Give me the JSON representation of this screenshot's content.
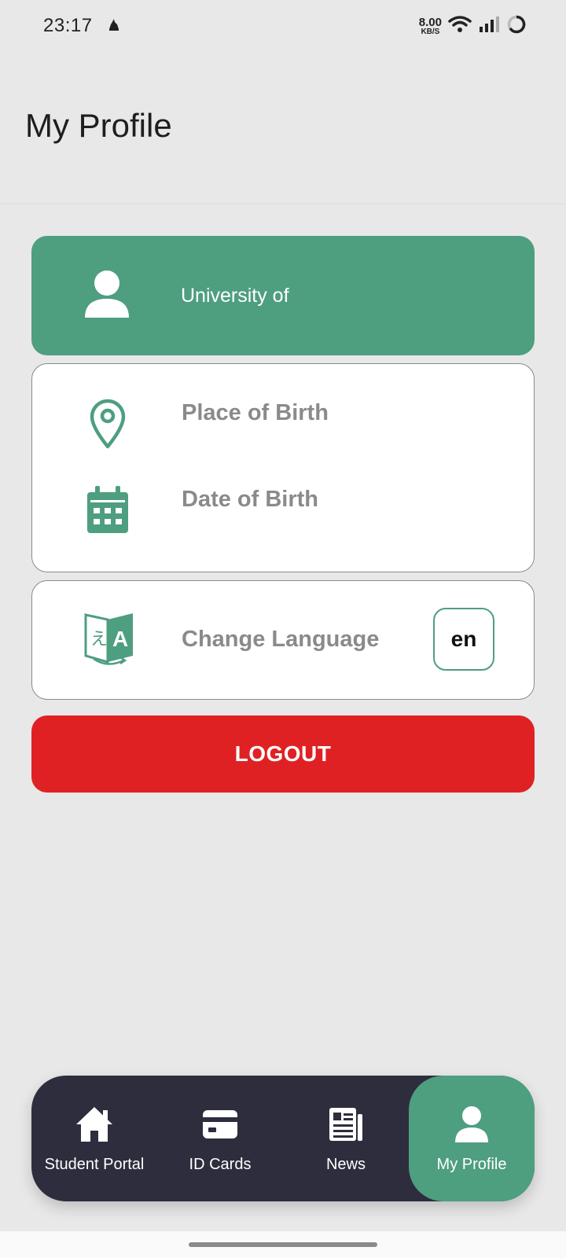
{
  "status_bar": {
    "time": "23:17",
    "net_speed_value": "8.00",
    "net_speed_unit": "KB/S",
    "icons": [
      "notification-icon",
      "wifi-icon",
      "signal-icon",
      "battery-icon"
    ]
  },
  "header": {
    "title": "My Profile"
  },
  "profile": {
    "university_label": "University of",
    "place_of_birth_label": "Place of Birth",
    "date_of_birth_label": "Date of Birth",
    "change_language_label": "Change Language",
    "language_code": "en",
    "logout_label": "LOGOUT"
  },
  "bottom_nav": {
    "items": [
      {
        "label": "Student Portal",
        "icon": "home-icon"
      },
      {
        "label": "ID Cards",
        "icon": "card-icon"
      },
      {
        "label": "News",
        "icon": "news-icon"
      },
      {
        "label": "My Profile",
        "icon": "person-icon"
      }
    ],
    "active_index": 3
  },
  "colors": {
    "accent": "#4e9e80",
    "logout": "#e02124",
    "nav_background": "#2e2d3d",
    "page_background": "#e8e8e8"
  }
}
